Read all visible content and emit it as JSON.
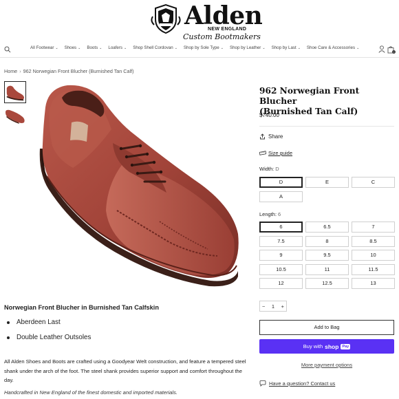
{
  "brand": {
    "name": "Alden",
    "sub": "NEW ENGLAND",
    "tagline": "Custom Bootmakers"
  },
  "nav": {
    "items": [
      {
        "label": "All Footwear"
      },
      {
        "label": "Shoes"
      },
      {
        "label": "Boots"
      },
      {
        "label": "Loafers"
      },
      {
        "label": "Shop Shell Cordovan"
      },
      {
        "label": "Shop by Sole Type"
      },
      {
        "label": "Shop by Leather"
      },
      {
        "label": "Shop by Last"
      },
      {
        "label": "Shoe Care & Accessories"
      }
    ],
    "cart_count": "0"
  },
  "breadcrumb": {
    "home": "Home",
    "current": "962 Norwegian Front Blucher (Burnished Tan Calf)"
  },
  "product": {
    "title_line1": "962 Norwegian Front Blucher",
    "title_line2": "(Burnished Tan Calf)",
    "price": "$740.00",
    "share_label": "Share",
    "size_guide_label": "Size guide",
    "width": {
      "label": "Width:",
      "selected": "D",
      "options": [
        "D",
        "E",
        "C",
        "A"
      ]
    },
    "length": {
      "label": "Length:",
      "selected": "6",
      "options": [
        "6",
        "6.5",
        "7",
        "7.5",
        "8",
        "8.5",
        "9",
        "9.5",
        "10",
        "10.5",
        "11",
        "11.5",
        "12",
        "12.5",
        "13"
      ]
    },
    "quantity": "1",
    "add_to_bag": "Add to Bag",
    "buy_with": "Buy with",
    "shop_logo": "shop",
    "shop_pay_badge": "Pay",
    "more_payment": "More payment options",
    "question": "Have a question? Contact us"
  },
  "description": {
    "title": "Norwegian Front Blucher in Burnished Tan Calfskin",
    "bullets": [
      "Aberdeen Last",
      "Double Leather Outsoles"
    ],
    "body": "All Alden Shoes and Boots are crafted using a Goodyear Welt construction, and feature a tempered steel shank under the arch of the foot. The steel shank provides superior support and comfort throughout the day.",
    "italic": "Handcrafted in New England of the finest domestic and imported materials."
  },
  "colors": {
    "shop_pay": "#5a31f4",
    "leather": "#a9483c"
  }
}
